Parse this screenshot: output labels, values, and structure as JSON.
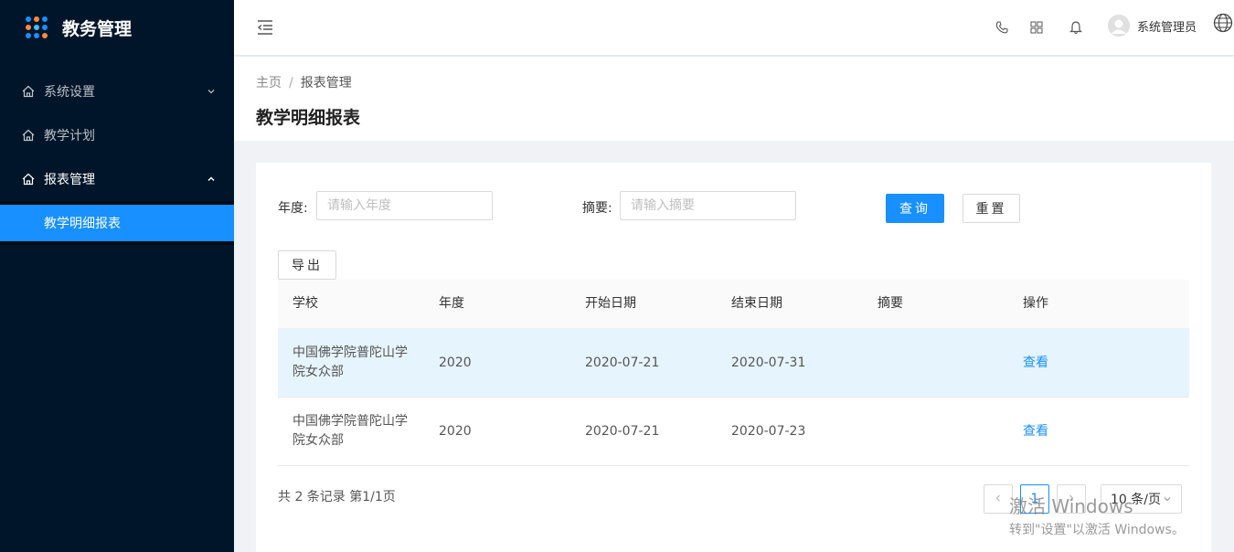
{
  "app": {
    "title": "教务管理"
  },
  "sidebar": {
    "items": [
      {
        "label": "系统设置",
        "icon": "home-icon",
        "expanded": false
      },
      {
        "label": "教学计划",
        "icon": "home-icon"
      },
      {
        "label": "报表管理",
        "icon": "home-icon",
        "expanded": true,
        "children": [
          {
            "label": "教学明细报表",
            "selected": true
          }
        ]
      }
    ]
  },
  "header": {
    "icons": [
      "menu-fold-icon",
      "phone-icon",
      "apps-icon",
      "bell-icon",
      "globe-icon"
    ],
    "user_name": "系统管理员"
  },
  "breadcrumb": {
    "home": "主页",
    "separator": "/",
    "current": "报表管理"
  },
  "page": {
    "title": "教学明细报表"
  },
  "filter": {
    "year_label": "年度:",
    "year_placeholder": "请输入年度",
    "summary_label": "摘要:",
    "summary_placeholder": "请输入摘要",
    "query_button": "查询",
    "reset_button": "重置"
  },
  "toolbar": {
    "export_button": "导出"
  },
  "table": {
    "columns": [
      "学校",
      "年度",
      "开始日期",
      "结束日期",
      "摘要",
      "操作"
    ],
    "rows": [
      {
        "school_line1": "中国佛学院普陀山学",
        "school_line2": "院女众部",
        "year": "2020",
        "start": "2020-07-21",
        "end": "2020-07-31",
        "summary": "",
        "action": "查看"
      },
      {
        "school_line1": "中国佛学院普陀山学",
        "school_line2": "院女众部",
        "year": "2020",
        "start": "2020-07-21",
        "end": "2020-07-23",
        "summary": "",
        "action": "查看"
      }
    ]
  },
  "pagination": {
    "summary": "共 2 条记录 第1/1页",
    "current_page": "1",
    "page_size": "10 条/页"
  },
  "watermark": {
    "line1": "激活 Windows",
    "line2": "转到\"设置\"以激活 Windows。"
  },
  "colors": {
    "sidebar_bg": "#001529",
    "primary": "#1890ff",
    "row_highlight": "#e6f4fd"
  }
}
